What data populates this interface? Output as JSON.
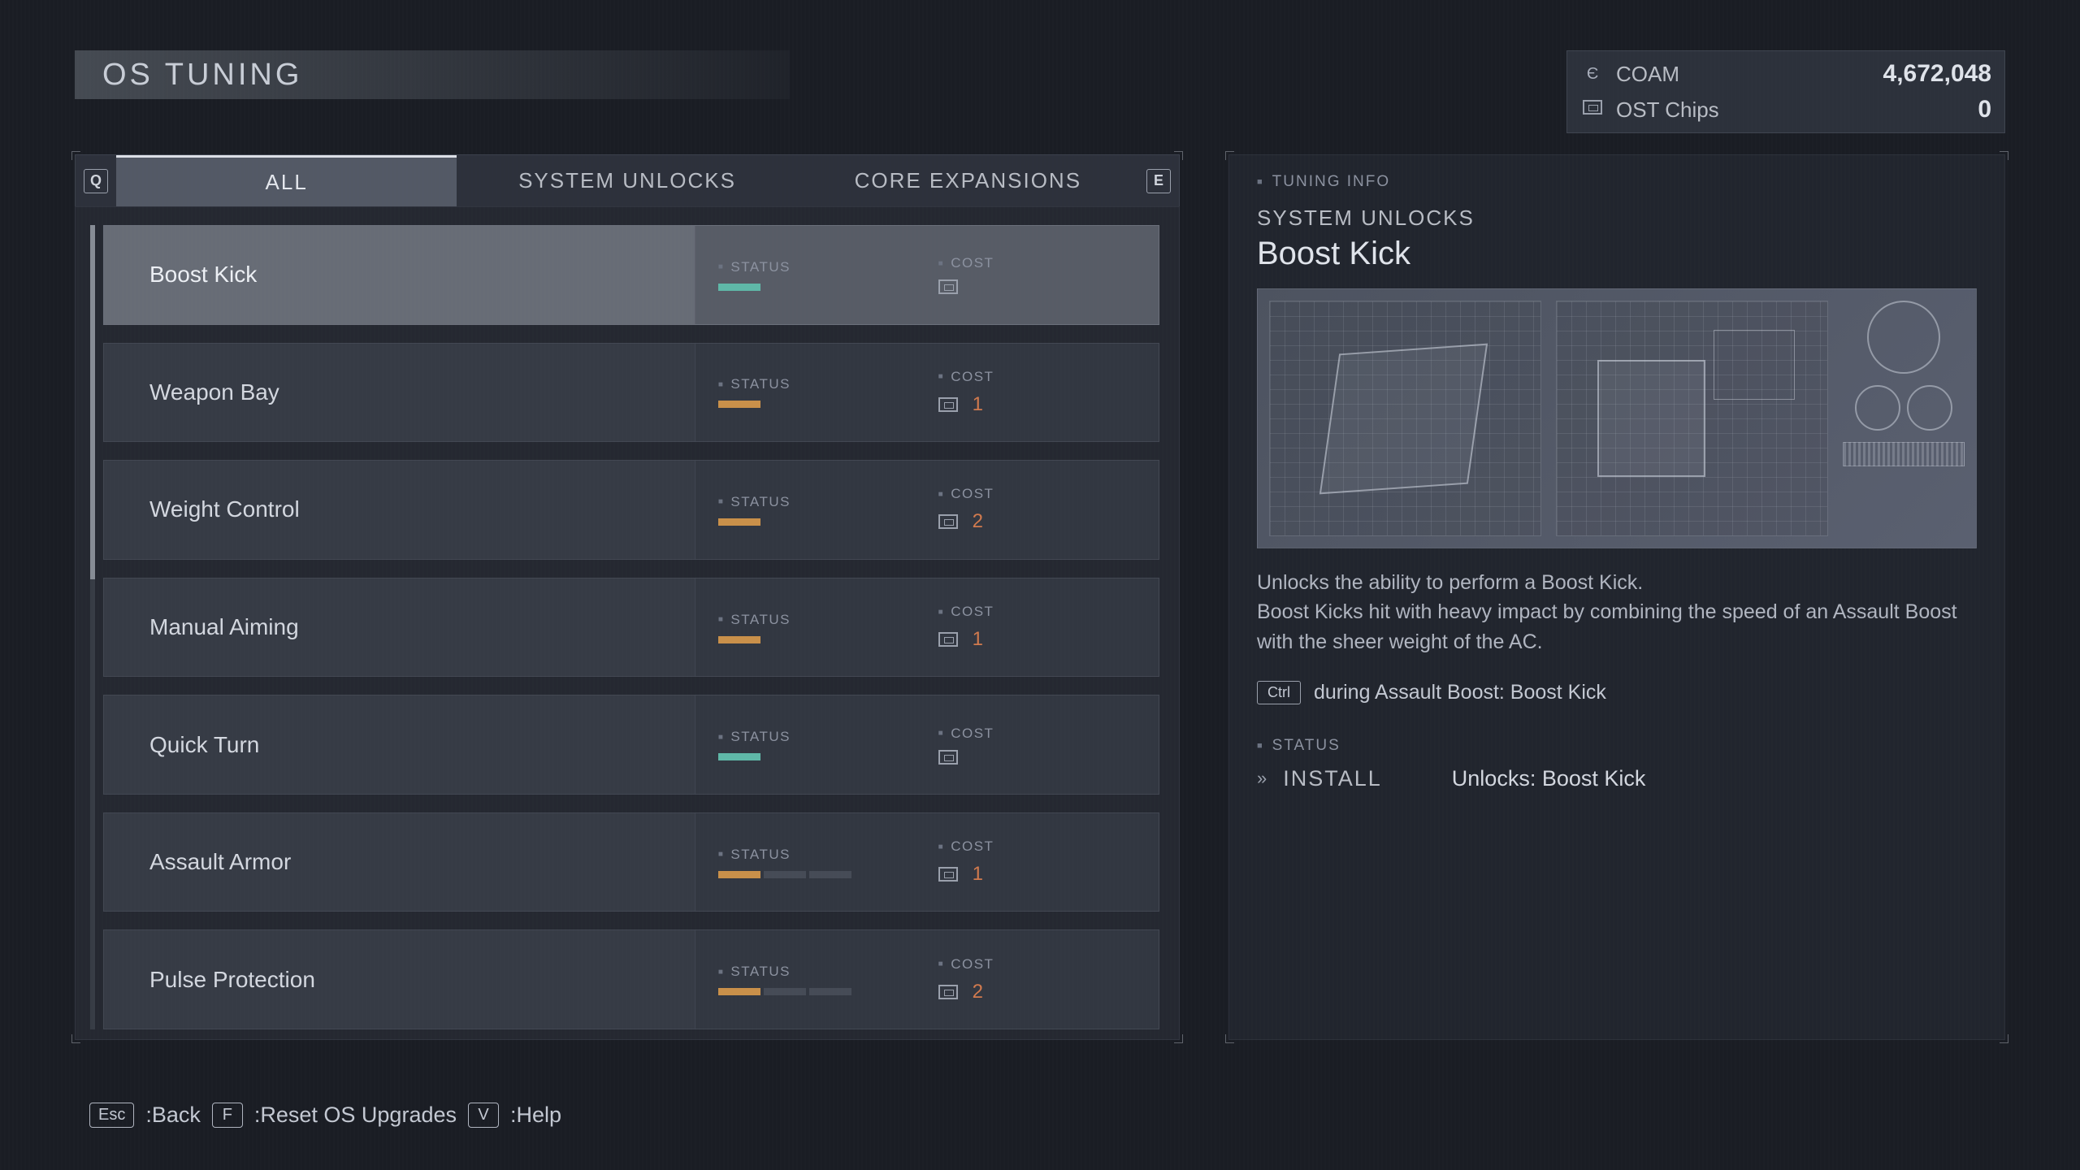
{
  "title": "OS TUNING",
  "currency": {
    "coam_label": "COAM",
    "coam_value": "4,672,048",
    "chips_label": "OST Chips",
    "chips_value": "0"
  },
  "tabs": {
    "key_prev": "Q",
    "key_next": "E",
    "items": [
      {
        "label": "ALL",
        "active": true
      },
      {
        "label": "SYSTEM UNLOCKS",
        "active": false
      },
      {
        "label": "CORE EXPANSIONS",
        "active": false
      }
    ]
  },
  "labels": {
    "status": "STATUS",
    "cost": "COST"
  },
  "list": [
    {
      "name": "Boost Kick",
      "selected": true,
      "status_color": "teal",
      "segments": 1,
      "cost": ""
    },
    {
      "name": "Weapon Bay",
      "selected": false,
      "status_color": "orange",
      "segments": 1,
      "cost": "1"
    },
    {
      "name": "Weight Control",
      "selected": false,
      "status_color": "orange",
      "segments": 1,
      "cost": "2"
    },
    {
      "name": "Manual Aiming",
      "selected": false,
      "status_color": "orange",
      "segments": 1,
      "cost": "1"
    },
    {
      "name": "Quick Turn",
      "selected": false,
      "status_color": "teal",
      "segments": 1,
      "cost": ""
    },
    {
      "name": "Assault Armor",
      "selected": false,
      "status_color": "orange",
      "segments": 3,
      "cost": "1"
    },
    {
      "name": "Pulse Protection",
      "selected": false,
      "status_color": "orange",
      "segments": 3,
      "cost": "2"
    }
  ],
  "info": {
    "section": "TUNING INFO",
    "category": "SYSTEM UNLOCKS",
    "name": "Boost Kick",
    "description": "Unlocks the ability to perform a Boost Kick.\nBoost Kicks hit with heavy impact by combining the speed of an Assault Boost with the sheer weight of the AC.",
    "control_key": "Ctrl",
    "control_text": "during Assault Boost: Boost Kick",
    "status_label": "STATUS",
    "install_label": "INSTALL",
    "install_effect": "Unlocks: Boost Kick"
  },
  "footer": {
    "back_key": "Esc",
    "back_label": ":Back",
    "reset_key": "F",
    "reset_label": ":Reset OS Upgrades",
    "help_key": "V",
    "help_label": ":Help"
  }
}
